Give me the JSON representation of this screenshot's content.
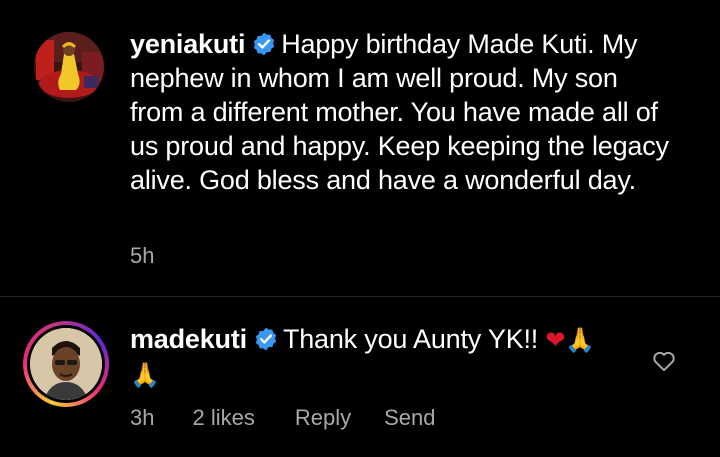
{
  "comments": [
    {
      "username": "yeniakuti",
      "verified": true,
      "text": "Happy birthday Made Kuti.  My nephew in whom I am well proud.  My son from a different mother.  You have made all of us proud and happy.  Keep keeping the legacy alive.  God bless and have a wonderful day.",
      "time": "5h",
      "avatar_icon": "profile-photo-woman-yellow"
    },
    {
      "username": "madekuti",
      "verified": true,
      "text": "Thank you Aunty YK!!",
      "emojis": {
        "heart": "❤",
        "pray1": "🙏",
        "pray2": "🙏"
      },
      "time": "3h",
      "likes": "2 likes",
      "reply_label": "Reply",
      "send_label": "Send",
      "avatar_icon": "profile-photo-man-story-ring",
      "like_icon": "heart-outline-icon"
    }
  ],
  "colors": {
    "background": "#000000",
    "text": "#ffffff",
    "meta_text": "#a8a8a8",
    "verified": "#3897f0",
    "divider": "#262626",
    "heart_emoji": "#e0142c"
  }
}
